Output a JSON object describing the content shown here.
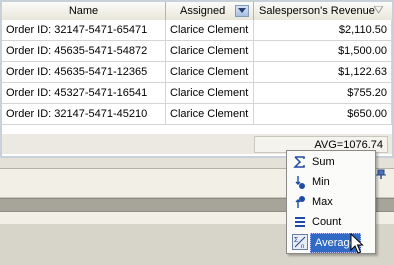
{
  "grid": {
    "columns": [
      "Name",
      "Assigned",
      "Salesperson's Revenue"
    ],
    "rows": [
      {
        "name": "Order ID: 32147-5471-65471",
        "assigned": "Clarice Clement",
        "revenue": "$2,110.50"
      },
      {
        "name": "Order ID: 45635-5471-54872",
        "assigned": "Clarice Clement",
        "revenue": "$1,500.00"
      },
      {
        "name": "Order ID: 45635-5471-12365",
        "assigned": "Clarice Clement",
        "revenue": "$1,122.63"
      },
      {
        "name": "Order ID: 45327-5471-16541",
        "assigned": "Clarice Clement",
        "revenue": "$755.20"
      },
      {
        "name": "Order ID: 32147-5471-45210",
        "assigned": "Clarice Clement",
        "revenue": "$650.00"
      }
    ],
    "aggregate": "AVG=1076.74"
  },
  "menu": {
    "items": [
      {
        "label": "Sum",
        "icon": "sigma-icon"
      },
      {
        "label": "Min",
        "icon": "min-icon"
      },
      {
        "label": "Max",
        "icon": "max-icon"
      },
      {
        "label": "Count",
        "icon": "count-icon"
      },
      {
        "label": "Average",
        "icon": "average-icon",
        "selected": true
      }
    ]
  },
  "colors": {
    "selection": "#316ac5",
    "header_gradient_bottom": "#e9e6da"
  }
}
